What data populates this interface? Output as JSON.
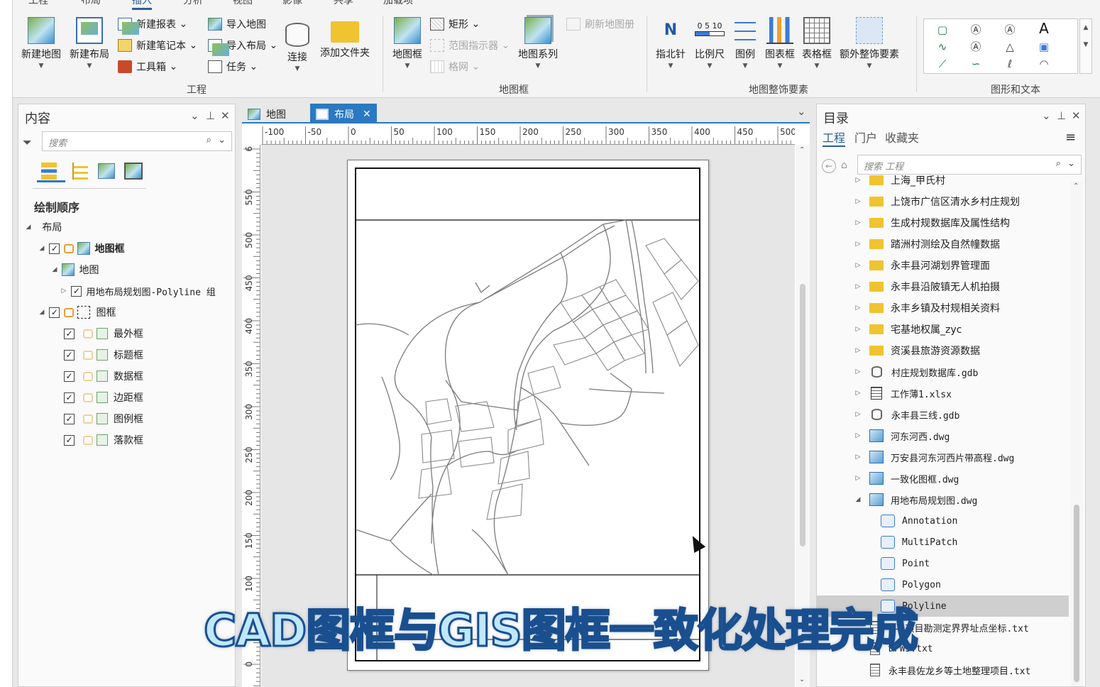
{
  "ribbon": {
    "tabs": [
      "工程",
      "布局",
      "插入",
      "分析",
      "视图",
      "影像",
      "共享",
      "加载项"
    ],
    "active_tab": "插入",
    "project_group": {
      "label": "工程",
      "new_map": "新建地图",
      "new_layout": "新建布局",
      "new_report": "新建报表",
      "new_notebook": "新建笔记本",
      "toolbox": "工具箱",
      "import_map": "导入地图",
      "import_layout": "导入布局",
      "task": "任务",
      "connect": "连接",
      "add_folder": "添加文件夹"
    },
    "mapframe_group": {
      "label": "地图框",
      "map_frame": "地图框",
      "rectangle": "矩形",
      "extent_indicator": "范围指示器",
      "grid": "格网",
      "refresh_map_series": "刷新地图册",
      "map_series": "地图系列"
    },
    "surround_group": {
      "label": "地图整饰要素",
      "north_arrow": "指北针",
      "north_arrow_glyph": "N",
      "scale_bar": "比例尺",
      "scale_bar_ticks": "0  5 10",
      "legend": "图例",
      "chart_frame": "图表框",
      "table_frame": "表格框",
      "extra_surround": "额外整饰要素"
    },
    "graphics_group": {
      "label": "图形和文本"
    }
  },
  "content_pane": {
    "title": "内容",
    "search_placeholder": "搜索",
    "drawing_order": "绘制顺序",
    "layout": "布局",
    "map_frame": "地图框",
    "map": "地图",
    "polyline_layer": "用地布局规划图-Polyline 组",
    "frame_group": "图框",
    "frame_items": [
      "最外框",
      "标题框",
      "数据框",
      "边距框",
      "图例框",
      "落款框"
    ]
  },
  "view_tabs": {
    "map_tab": "地图",
    "layout_tab": "布局"
  },
  "rulers": {
    "horizontal": [
      "-100",
      "-50",
      "0",
      "50",
      "100",
      "150",
      "200",
      "250",
      "300",
      "350",
      "400",
      "450",
      "500"
    ],
    "vertical": [
      "6",
      "550",
      "500",
      "450",
      "400",
      "350",
      "300",
      "250",
      "200",
      "150",
      "100",
      "50",
      "0"
    ]
  },
  "catalog_pane": {
    "title": "目录",
    "tabs": [
      "工程",
      "门户",
      "收藏夹"
    ],
    "search_placeholder": "搜索 工程",
    "items": [
      {
        "text": "上海_甲氏村",
        "type": "folder",
        "level": 0
      },
      {
        "text": "上饶市广信区清水乡村庄规划",
        "type": "folder",
        "level": 0
      },
      {
        "text": "生成村规数据库及属性结构",
        "type": "folder",
        "level": 0
      },
      {
        "text": "踏洲村测绘及自然幢数据",
        "type": "folder",
        "level": 0
      },
      {
        "text": "永丰县河湖划界管理面",
        "type": "folder",
        "level": 0
      },
      {
        "text": "永丰县沿陂镇无人机拍摄",
        "type": "folder",
        "level": 0
      },
      {
        "text": "永丰乡镇及村规相关资料",
        "type": "folder",
        "level": 0
      },
      {
        "text": "宅基地权属_zyc",
        "type": "folder",
        "level": 0
      },
      {
        "text": "资溪县旅游资源数据",
        "type": "folder",
        "level": 0
      },
      {
        "text": "村庄规划数据库.gdb",
        "type": "gdb",
        "level": 0
      },
      {
        "text": "工作薄1.xlsx",
        "type": "xlsx",
        "level": 0
      },
      {
        "text": "永丰县三线.gdb",
        "type": "gdb",
        "level": 0
      },
      {
        "text": "河东河西.dwg",
        "type": "dwg",
        "level": 0
      },
      {
        "text": "万安县河东河西片带高程.dwg",
        "type": "dwg",
        "level": 0
      },
      {
        "text": "一致化图框.dwg",
        "type": "dwg",
        "level": 0
      },
      {
        "text": "用地布局规划图.dwg",
        "type": "dwg",
        "level": 0,
        "expanded": true
      },
      {
        "text": "Annotation",
        "type": "ft",
        "level": 1
      },
      {
        "text": "MultiPatch",
        "type": "ft",
        "level": 1
      },
      {
        "text": "Point",
        "type": "ft",
        "level": 1
      },
      {
        "text": "Polygon",
        "type": "ft",
        "level": 1
      },
      {
        "text": "Polyline",
        "type": "ft",
        "level": 1,
        "selected": true
      },
      {
        "text": "7-1项目勘测定界界址点坐标.txt",
        "type": "txt",
        "level": 0
      },
      {
        "text": "DFW3.txt",
        "type": "txt",
        "level": 0
      },
      {
        "text": "永丰县佐龙乡等土地整理项目.txt",
        "type": "txt",
        "level": 0
      }
    ]
  },
  "subtitle": "CAD图框与GIS图框一致化处理完成",
  "colors": {
    "accent": "#2b79c2",
    "subtitle_fill": "#bfe8ff",
    "subtitle_stroke": "#1a4f8f"
  }
}
